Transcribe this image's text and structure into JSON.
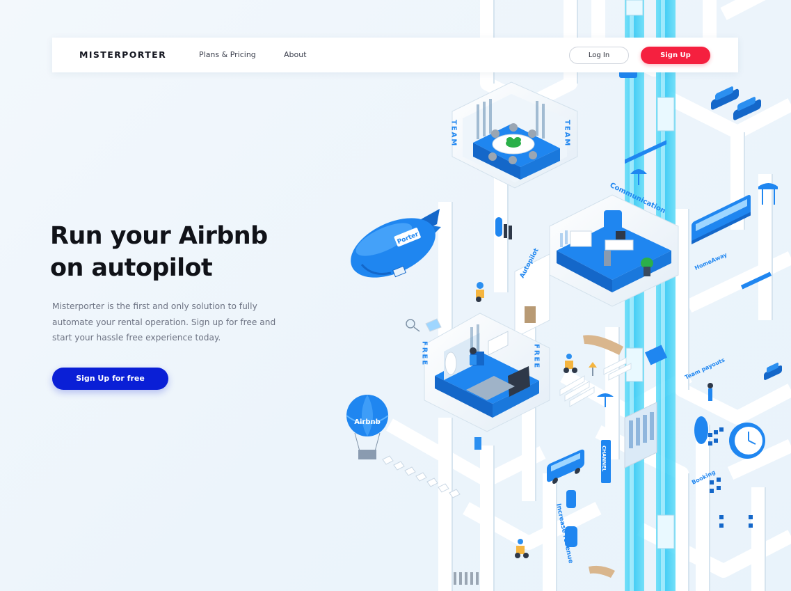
{
  "brand": "MISTERPORTER",
  "nav": {
    "plans": "Plans & Pricing",
    "about": "About",
    "login": "Log In",
    "signup": "Sign Up"
  },
  "hero": {
    "title_line1": "Run your Airbnb",
    "title_line2": "on autopilot",
    "description": "Misterporter is the first and only solution to fully automate your rental operation. Sign up for free and start  your hassle free experience today.",
    "cta": "Sign Up for free"
  },
  "illustration": {
    "labels": {
      "team_left": "TEAM",
      "team_right": "TEAM",
      "communication": "Communication",
      "blimp": "Porter",
      "balloon": "Airbnb",
      "autopilot": "Autopilot",
      "free_left": "FREE",
      "free_right": "FREE",
      "homeaway": "HomeAway",
      "team_payouts": "Team payouts",
      "channel": "CHANNEL",
      "booking": "Booking",
      "increase_revenue": "Increase revenue"
    }
  },
  "colors": {
    "brand_blue": "#0a1fd6",
    "signup_red": "#f5203f",
    "illustration_blue": "#1f86f0",
    "beam_cyan": "#3fd0f5",
    "structure_white": "#ffffff"
  }
}
